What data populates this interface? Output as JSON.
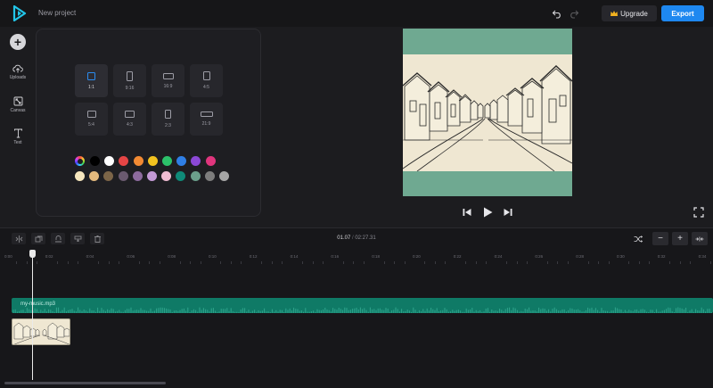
{
  "header": {
    "project_name": "New project",
    "upgrade_label": "Upgrade",
    "export_label": "Export"
  },
  "sidebar": {
    "items": [
      {
        "label": "Uploads",
        "icon": "upload-cloud-icon"
      },
      {
        "label": "Canvas",
        "icon": "canvas-resize-icon"
      },
      {
        "label": "Text",
        "icon": "text-icon"
      }
    ]
  },
  "canvas_panel": {
    "ratios": [
      "1:1",
      "9:16",
      "16:9",
      "4:5",
      "5:4",
      "4:3",
      "2:3",
      "21:9"
    ],
    "selected_ratio": "1:1",
    "colors_row1": [
      "#000000",
      "#ffffff",
      "#e64545",
      "#f28a33",
      "#f2c21f",
      "#2cc16a",
      "#2f7fe6",
      "#8b48d6",
      "#e0357d"
    ],
    "colors_row2": [
      "#f6e6bd",
      "#e3b97d",
      "#7c6548",
      "#6a5a6f",
      "#8d6b9e",
      "#c49ad6",
      "#f0bcd2",
      "#0f8a78",
      "#6b9f8b",
      "#7d7d7d",
      "#a6a6a6"
    ]
  },
  "preview": {
    "background_color": "#6fa991"
  },
  "timeline": {
    "current_time": "01.07",
    "separator": "/",
    "total_time": "02:27.31",
    "ruler_labels": [
      "0:00",
      "0:02",
      "0:04",
      "0:06",
      "0:08",
      "0:10",
      "0:12",
      "0:14",
      "0:16",
      "0:18",
      "0:20",
      "0:22",
      "0:24",
      "0:26",
      "0:28",
      "0:30",
      "0:32",
      "0:34"
    ],
    "audio_track_name": "my-music.mp3",
    "zoom_out_label": "−",
    "zoom_in_label": "+"
  }
}
